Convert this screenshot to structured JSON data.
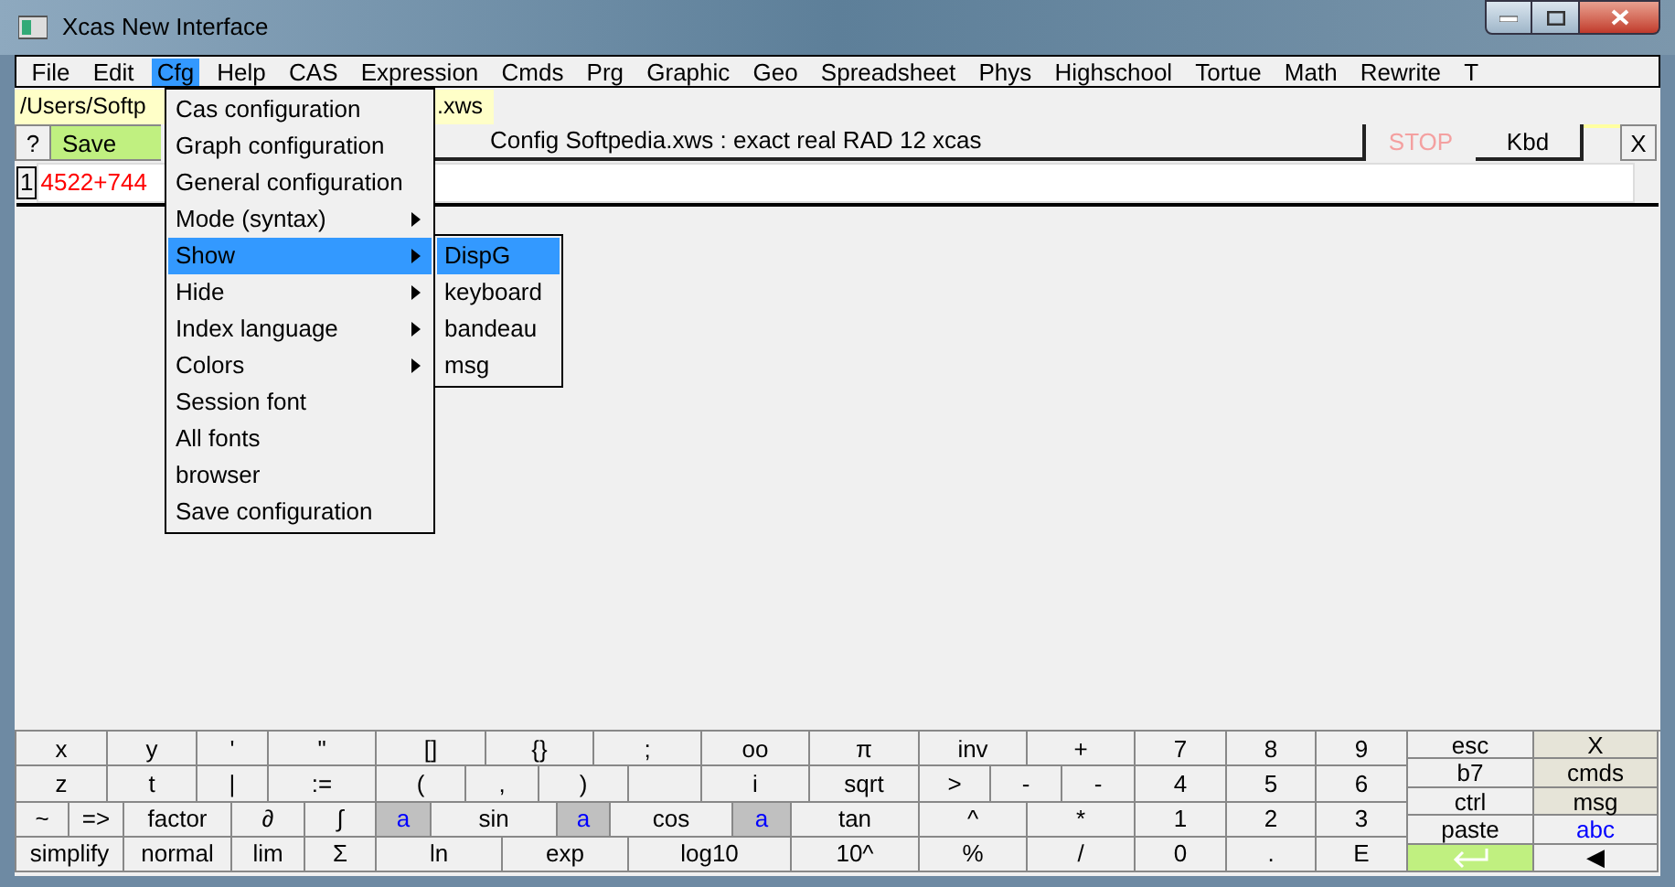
{
  "window": {
    "title": "Xcas New Interface"
  },
  "menu_bar": [
    {
      "label": "File",
      "selected": false
    },
    {
      "label": "Edit",
      "selected": false
    },
    {
      "label": "Cfg",
      "selected": true
    },
    {
      "label": "Help",
      "selected": false
    },
    {
      "label": "CAS",
      "selected": false
    },
    {
      "label": "Expression",
      "selected": false
    },
    {
      "label": "Cmds",
      "selected": false
    },
    {
      "label": "Prg",
      "selected": false
    },
    {
      "label": "Graphic",
      "selected": false
    },
    {
      "label": "Geo",
      "selected": false
    },
    {
      "label": "Spreadsheet",
      "selected": false
    },
    {
      "label": "Phys",
      "selected": false
    },
    {
      "label": "Highschool",
      "selected": false
    },
    {
      "label": "Tortue",
      "selected": false
    },
    {
      "label": "Math",
      "selected": false
    },
    {
      "label": "Rewrite",
      "selected": false
    },
    {
      "label": "T",
      "selected": false
    }
  ],
  "cfg_menu": [
    {
      "label": "Cas configuration",
      "submenu": false,
      "selected": false
    },
    {
      "label": "Graph configuration",
      "submenu": false,
      "selected": false
    },
    {
      "label": "General configuration",
      "submenu": false,
      "selected": false
    },
    {
      "label": "Mode (syntax)",
      "submenu": true,
      "selected": false
    },
    {
      "label": "Show",
      "submenu": true,
      "selected": true
    },
    {
      "label": "Hide",
      "submenu": true,
      "selected": false
    },
    {
      "label": "Index language",
      "submenu": true,
      "selected": false
    },
    {
      "label": "Colors",
      "submenu": true,
      "selected": false
    },
    {
      "label": "Session font",
      "submenu": false,
      "selected": false
    },
    {
      "label": "All fonts",
      "submenu": false,
      "selected": false
    },
    {
      "label": "browser",
      "submenu": false,
      "selected": false
    },
    {
      "label": "Save configuration",
      "submenu": false,
      "selected": false
    }
  ],
  "show_submenu": [
    {
      "label": "DispG",
      "selected": true
    },
    {
      "label": "keyboard",
      "selected": false
    },
    {
      "label": "bandeau",
      "selected": false
    },
    {
      "label": "msg",
      "selected": false
    }
  ],
  "file_tab": {
    "label_start": "/Users/Softp",
    "label_end": ".xws"
  },
  "toolbar": {
    "help": "?",
    "save": "Save",
    "status": "Config Softpedia.xws : exact real RAD 12 xcas",
    "stop": "STOP",
    "kbd": "Kbd",
    "close": "X"
  },
  "entry": {
    "number": "1",
    "expression": "4522+744"
  },
  "keyboard": {
    "function_keys": [
      [
        {
          "label": "x",
          "kind": "key"
        },
        {
          "label": "y",
          "kind": "key"
        },
        {
          "label": "'",
          "kind": "key"
        },
        {
          "label": "\"",
          "kind": "key"
        },
        {
          "label": "[]",
          "kind": "key"
        },
        {
          "label": "{}",
          "kind": "key"
        },
        {
          "label": ";",
          "kind": "key"
        },
        {
          "label": "oo",
          "kind": "key"
        },
        {
          "label": "π",
          "kind": "key"
        },
        {
          "label": "inv",
          "kind": "key"
        },
        {
          "label": "+",
          "kind": "key"
        }
      ],
      [
        {
          "label": "z",
          "kind": "key"
        },
        {
          "label": "t",
          "kind": "key"
        },
        {
          "label": "|",
          "kind": "key"
        },
        {
          "label": ":=",
          "kind": "key"
        },
        {
          "label": "(",
          "kind": "key"
        },
        {
          "label": ",",
          "kind": "key"
        },
        {
          "label": ")",
          "kind": "key"
        },
        {
          "kind": "blank"
        },
        {
          "label": "i",
          "kind": "key"
        },
        {
          "label": "sqrt",
          "kind": "key"
        },
        {
          "label": ">",
          "kind": "key"
        },
        {
          "label": "-",
          "kind": "key"
        },
        {
          "label": "-",
          "kind": "key"
        }
      ],
      [
        {
          "label": "~",
          "kind": "key"
        },
        {
          "label": "=>",
          "kind": "key"
        },
        {
          "label": "factor",
          "kind": "key"
        },
        {
          "label": "∂",
          "kind": "key"
        },
        {
          "label": "∫",
          "kind": "key"
        },
        {
          "label": "a",
          "kind": "var"
        },
        {
          "label": "sin",
          "kind": "key"
        },
        {
          "label": "a",
          "kind": "var"
        },
        {
          "label": "cos",
          "kind": "key"
        },
        {
          "label": "a",
          "kind": "var"
        },
        {
          "label": "tan",
          "kind": "key"
        },
        {
          "label": "^",
          "kind": "key"
        },
        {
          "label": "*",
          "kind": "key"
        }
      ],
      [
        {
          "label": "simplify",
          "kind": "key"
        },
        {
          "label": "normal",
          "kind": "key"
        },
        {
          "label": "lim",
          "kind": "key"
        },
        {
          "label": "Σ",
          "kind": "key"
        },
        {
          "label": "ln",
          "kind": "key"
        },
        {
          "label": "exp",
          "kind": "key"
        },
        {
          "label": "log10",
          "kind": "key"
        },
        {
          "label": "10^",
          "kind": "key"
        },
        {
          "label": "%",
          "kind": "key"
        },
        {
          "label": "/",
          "kind": "key"
        }
      ]
    ],
    "number_pad": [
      [
        "7",
        "8",
        "9"
      ],
      [
        "4",
        "5",
        "6"
      ],
      [
        "1",
        "2",
        "3"
      ],
      [
        "0",
        ".",
        "E"
      ]
    ],
    "side": [
      [
        {
          "label": "esc",
          "kind": "key"
        },
        {
          "label": "X",
          "kind": "accent"
        }
      ],
      [
        {
          "label": "b7",
          "kind": "key"
        },
        {
          "label": "cmds",
          "kind": "accent"
        }
      ],
      [
        {
          "label": "ctrl",
          "kind": "key"
        },
        {
          "label": "msg",
          "kind": "accent"
        }
      ],
      [
        {
          "label": "paste",
          "kind": "key"
        },
        {
          "label": "abc",
          "kind": "blue"
        }
      ],
      [
        {
          "kind": "enter"
        },
        {
          "label": "◀",
          "kind": "key"
        }
      ]
    ]
  }
}
